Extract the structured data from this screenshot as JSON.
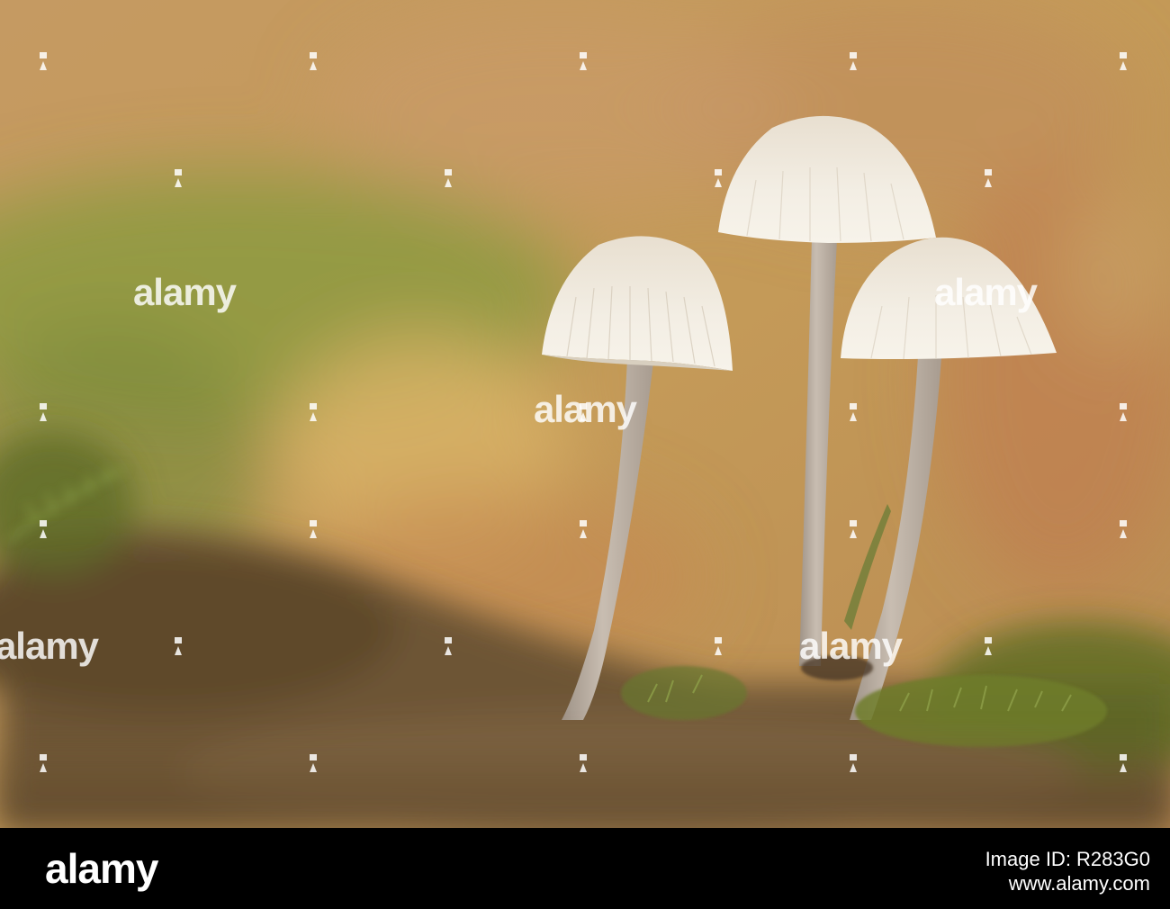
{
  "watermark": {
    "brand": "alamy",
    "image_id": "Image ID: R283G0",
    "url": "www.alamy.com"
  },
  "scene": {
    "subject": "three pale bonnet mushrooms",
    "colors": {
      "background_warm": "#c79a5e",
      "background_green": "#8a9a3e",
      "cap": "#efe9dd",
      "stem": "#bfb3a6",
      "moss": "#6d7a2a"
    }
  }
}
